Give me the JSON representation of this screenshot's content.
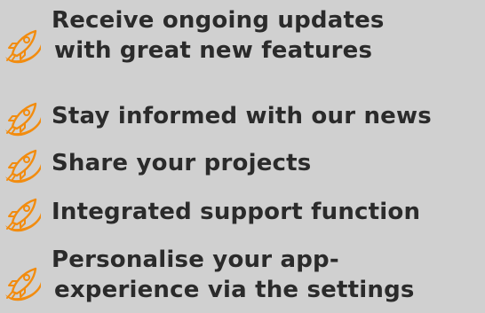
{
  "features": {
    "icon": "rocket-icon",
    "accent_color": "#f28c0f",
    "text_color": "#2b2b2b",
    "background_color": "#d0d0d0",
    "items": [
      {
        "lines": [
          "Receive ongoing updates",
          "with great new features"
        ]
      },
      {
        "lines": [
          "Stay informed with our news"
        ]
      },
      {
        "lines": [
          "Share your projects"
        ]
      },
      {
        "lines": [
          "Integrated support function"
        ]
      },
      {
        "lines": [
          "Personalise your app-",
          "experience via the settings"
        ]
      }
    ]
  }
}
